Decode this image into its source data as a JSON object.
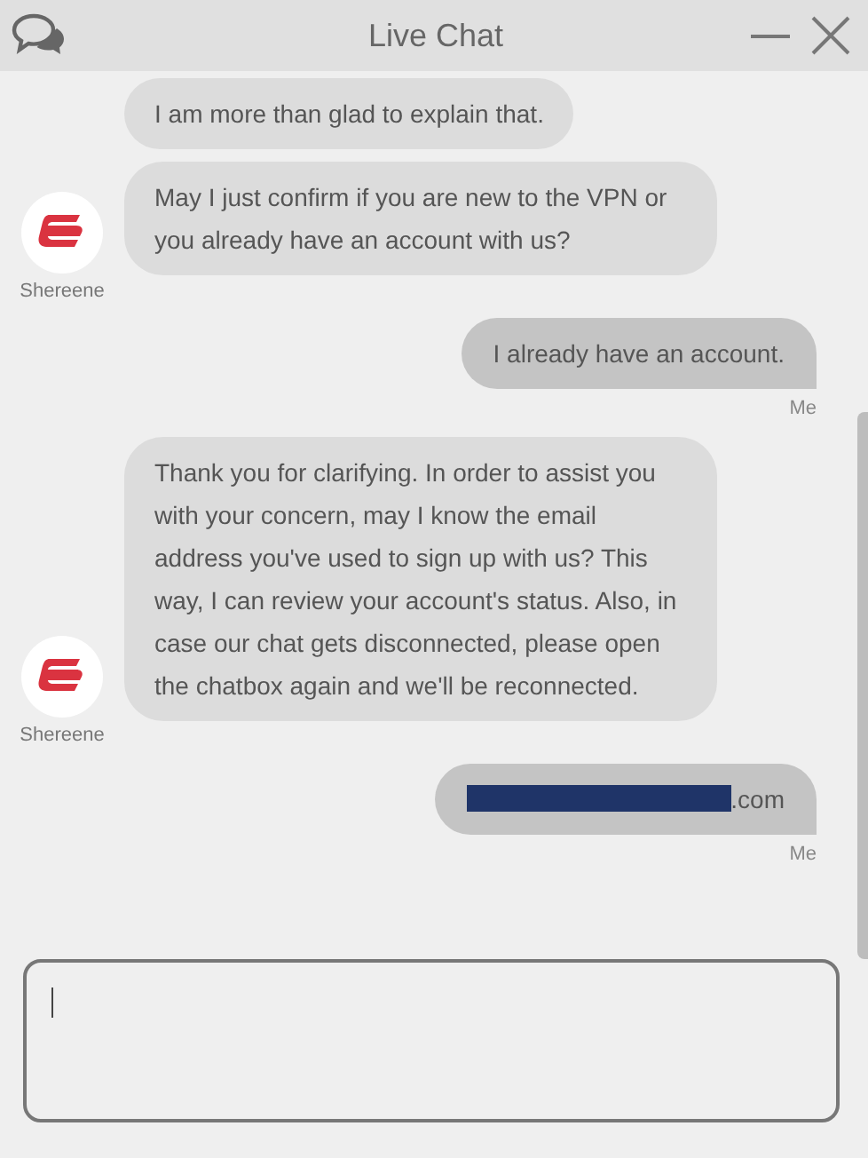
{
  "window": {
    "title": "Live Chat"
  },
  "messages": [
    {
      "kind": "agent",
      "name": "Shereene",
      "bubbles": [
        {
          "text": "I am more than glad to explain that."
        },
        {
          "text": "May I just confirm if you are new to the VPN or you already have an account with us?"
        }
      ]
    },
    {
      "kind": "me",
      "name": "Me",
      "bubbles": [
        {
          "text": "I already have an account."
        }
      ]
    },
    {
      "kind": "agent",
      "name": "Shereene",
      "bubbles": [
        {
          "text": "Thank you for clarifying. In order to assist you with your concern, may I know the email address you've used to sign up with us? This way, I can review your account's status. Also, in case our chat gets disconnected, please open the chatbox again and we'll be reconnected."
        }
      ]
    },
    {
      "kind": "me",
      "name": "Me",
      "bubbles": [
        {
          "text": ".com",
          "redacted": true
        }
      ]
    }
  ]
}
